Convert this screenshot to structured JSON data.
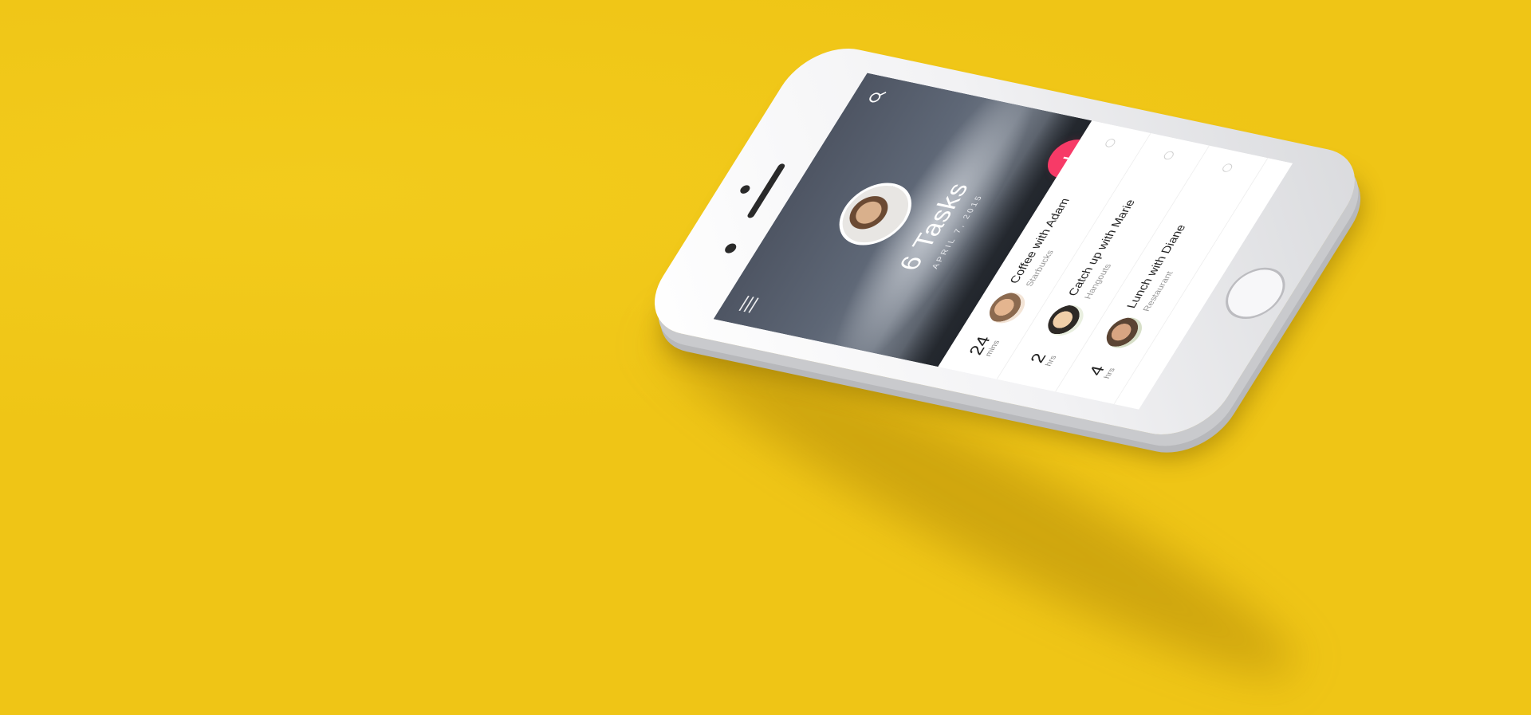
{
  "background_color": "#efc516",
  "accent_color": "#f73a67",
  "header": {
    "menu_icon": "hamburger-icon",
    "search_icon": "search-icon",
    "task_count": "6 Tasks",
    "date": "APRIL 7, 2015"
  },
  "fab": {
    "label": "+",
    "icon": "plus-icon"
  },
  "tasks": [
    {
      "duration": "24",
      "unit": "mins",
      "title": "Coffee with Adam",
      "subtitle": "Starbucks"
    },
    {
      "duration": "2",
      "unit": "hrs",
      "title": "Catch up with Marie",
      "subtitle": "Hangouts"
    },
    {
      "duration": "4",
      "unit": "hrs",
      "title": "Lunch with Diane",
      "subtitle": "Restaurant"
    }
  ]
}
